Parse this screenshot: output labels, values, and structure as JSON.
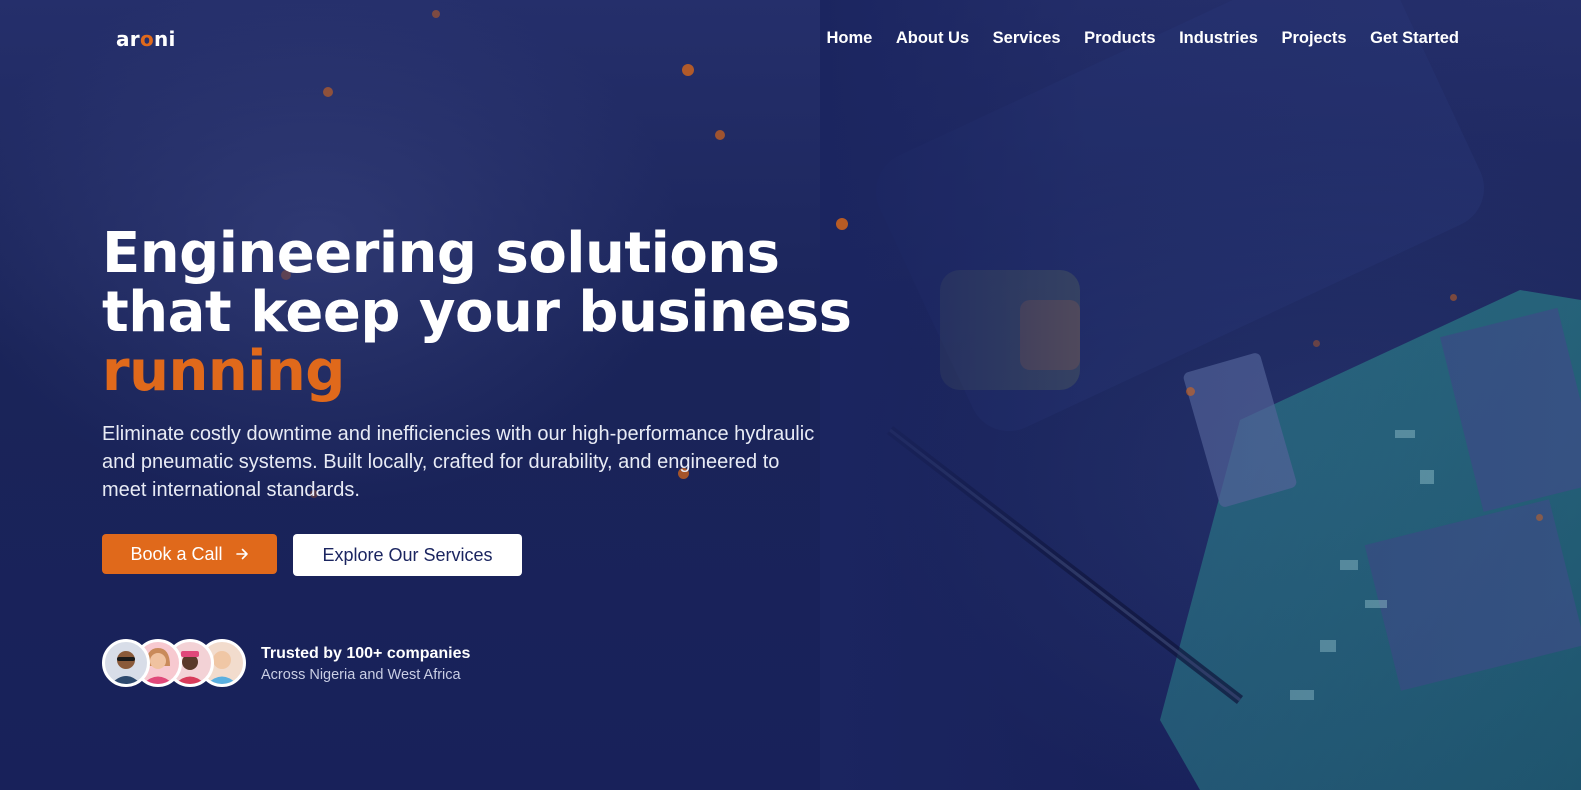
{
  "brand": {
    "logo_prefix": "ar",
    "logo_o": "o",
    "logo_suffix": "ni",
    "accent_color": "#e0691b",
    "background_color": "#1b2560"
  },
  "nav": {
    "links": [
      "Home",
      "About Us",
      "Services",
      "Products",
      "Industries",
      "Projects",
      "Get Started"
    ]
  },
  "hero": {
    "title_line1": "Engineering solutions",
    "title_line2": "that keep your business",
    "title_accent": "running",
    "description": "Eliminate costly downtime and inefficiencies with our high-performance hydraulic and pneumatic systems. Built locally, crafted for durability, and engineered to meet international standards.",
    "primary_cta": "Book a Call",
    "primary_cta_icon": "arrow-right-icon",
    "secondary_cta": "Explore Our Services"
  },
  "trust": {
    "title": "Trusted by 100+ companies",
    "subtitle": "Across Nigeria and West Africa",
    "avatar_icons": [
      "avatar-man-sunglasses",
      "avatar-woman",
      "avatar-man-cap",
      "avatar-man-bald"
    ]
  }
}
